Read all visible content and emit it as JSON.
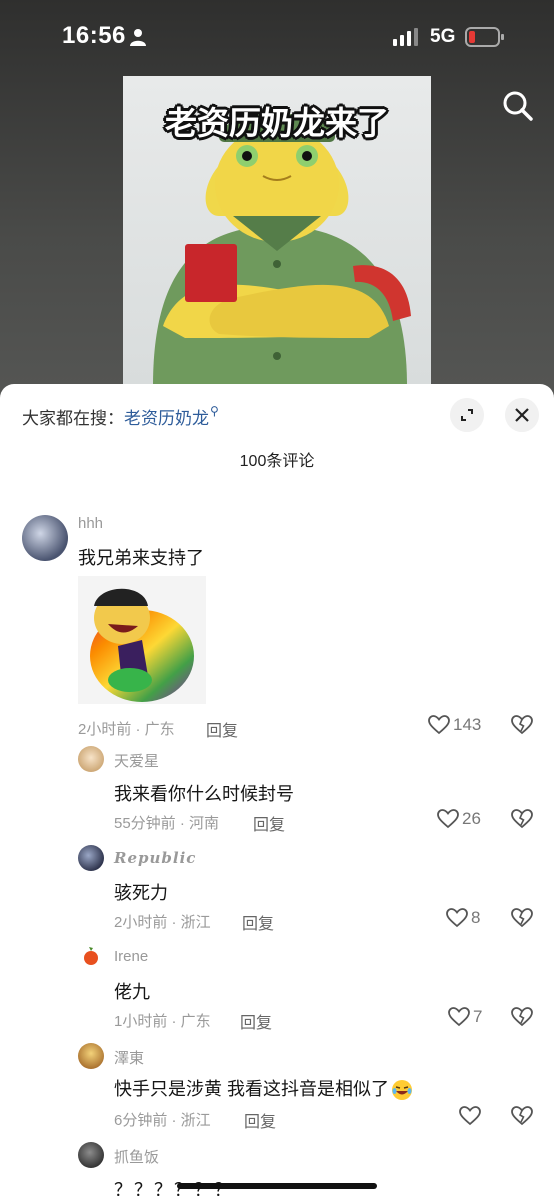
{
  "status": {
    "time": "16:56",
    "network": "5G"
  },
  "video": {
    "caption": "老资历奶龙来了"
  },
  "search_hint": {
    "prefix": "大家都在搜：",
    "keyword": "老资历奶龙"
  },
  "comments_header": {
    "count_label": "100条评论"
  },
  "comments": [
    {
      "user": "hhh",
      "text": "我兄弟来支持了",
      "meta": "2小时前 · 广东",
      "reply": "回复",
      "likes": "143"
    },
    {
      "user": "天爱星",
      "text": "我来看你什么时候封号",
      "meta": "55分钟前 · 河南",
      "reply": "回复",
      "likes": "26"
    },
    {
      "user": "Republic",
      "text": "骇死力",
      "meta": "2小时前 · 浙江",
      "reply": "回复",
      "likes": "8"
    },
    {
      "user": "Irene",
      "text": "佬九",
      "meta": "1小时前 · 广东",
      "reply": "回复",
      "likes": "7"
    },
    {
      "user": "澤東",
      "text": "快手只是涉黄 我看这抖音是相似了",
      "meta": "6分钟前 · 浙江",
      "reply": "回复",
      "likes": ""
    },
    {
      "user": "抓鱼饭",
      "text": "？？？？？？"
    }
  ],
  "colors": {
    "accent_link": "#2e5c9a",
    "sheet_bg": "#ffffff",
    "video_bg": "#3a3b3a"
  }
}
